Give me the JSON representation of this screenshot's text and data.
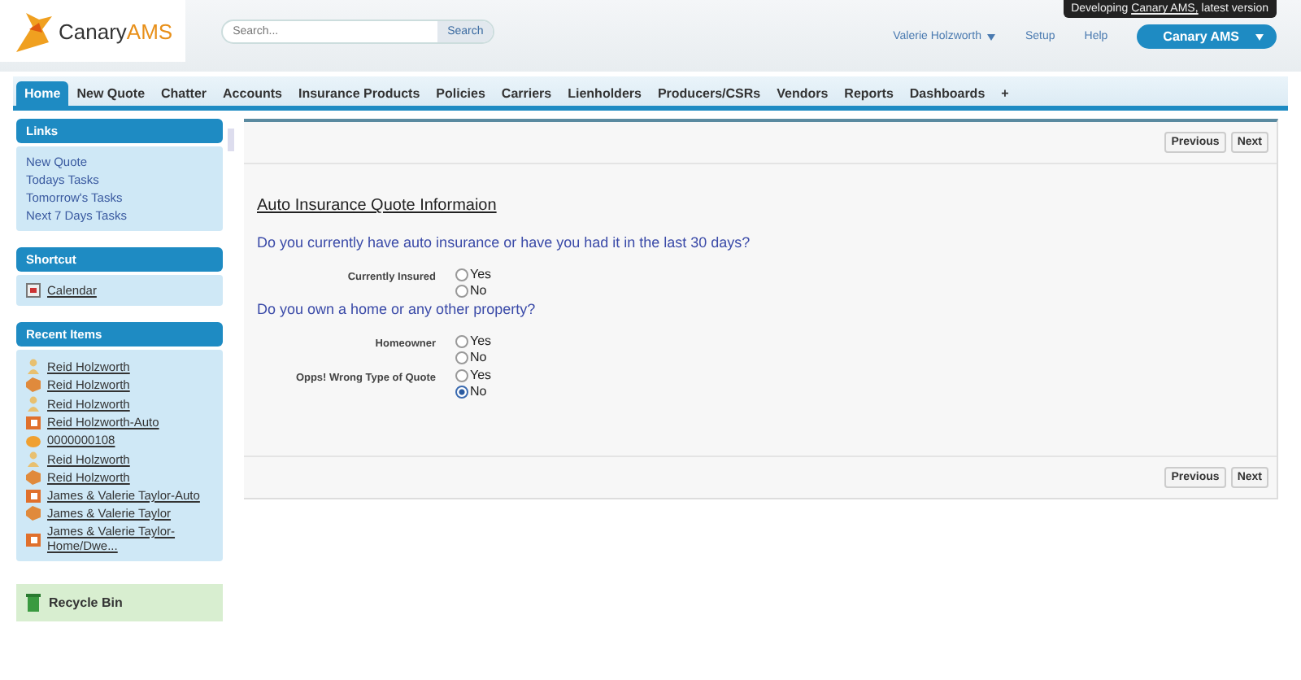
{
  "header": {
    "logo": {
      "name": "Canary",
      "suffix": "AMS"
    },
    "search": {
      "placeholder": "Search...",
      "button": "Search"
    },
    "tooltip": {
      "before": "Developing ",
      "link": "Canary AMS,",
      "after": " latest version"
    },
    "user": "Valerie Holzworth",
    "links": [
      "Setup",
      "Help"
    ],
    "app_menu": "Canary AMS"
  },
  "tabs": [
    {
      "label": "Home",
      "selected": true
    },
    {
      "label": "New Quote",
      "selected": false
    },
    {
      "label": "Chatter",
      "selected": false
    },
    {
      "label": "Accounts",
      "selected": false
    },
    {
      "label": "Insurance Products",
      "selected": false
    },
    {
      "label": "Policies",
      "selected": false
    },
    {
      "label": "Carriers",
      "selected": false
    },
    {
      "label": "Lienholders",
      "selected": false
    },
    {
      "label": "Producers/CSRs",
      "selected": false
    },
    {
      "label": "Vendors",
      "selected": false
    },
    {
      "label": "Reports",
      "selected": false
    },
    {
      "label": "Dashboards",
      "selected": false
    },
    {
      "label": "+",
      "selected": false
    }
  ],
  "sidebar": {
    "links": {
      "title": "Links",
      "items": [
        "New Quote",
        "Todays Tasks",
        "Tomorrow's Tasks",
        "Next 7 Days Tasks"
      ]
    },
    "shortcut": {
      "title": "Shortcut",
      "items": [
        "Calendar"
      ]
    },
    "recent": {
      "title": "Recent Items",
      "items": [
        {
          "label": "Reid Holzworth",
          "kind": "person"
        },
        {
          "label": "Reid Holzworth",
          "kind": "account"
        },
        {
          "label": "Reid Holzworth",
          "kind": "person"
        },
        {
          "label": "Reid Holzworth-Auto",
          "kind": "policy"
        },
        {
          "label": "0000000108",
          "kind": "quote"
        },
        {
          "label": "Reid Holzworth",
          "kind": "person"
        },
        {
          "label": "Reid Holzworth",
          "kind": "account"
        },
        {
          "label": "James & Valerie Taylor-Auto",
          "kind": "policy"
        },
        {
          "label": "James & Valerie Taylor",
          "kind": "account"
        },
        {
          "label": "James & Valerie Taylor-Home/Dwe...",
          "kind": "policy"
        }
      ]
    },
    "recycle_bin": "Recycle Bin"
  },
  "form": {
    "top_buttons": [
      "Previous",
      "Next"
    ],
    "bottom_buttons": [
      "Previous",
      "Next"
    ],
    "title": "Auto Insurance Quote Informaion",
    "sections": [
      {
        "question": "Do you currently have auto insurance or have you had it in the last 30 days?",
        "fields": [
          {
            "label": "Currently Insured",
            "options": [
              {
                "label": "Yes",
                "selected": false
              },
              {
                "label": "No",
                "selected": false
              }
            ]
          }
        ]
      },
      {
        "question": "Do you own a home or any other property?",
        "fields": [
          {
            "label": "Homeowner",
            "options": [
              {
                "label": "Yes",
                "selected": false
              },
              {
                "label": "No",
                "selected": false
              }
            ]
          },
          {
            "label": "Opps! Wrong Type of Quote",
            "options": [
              {
                "label": "Yes",
                "selected": false
              },
              {
                "label": "No",
                "selected": true
              }
            ]
          }
        ]
      }
    ]
  }
}
